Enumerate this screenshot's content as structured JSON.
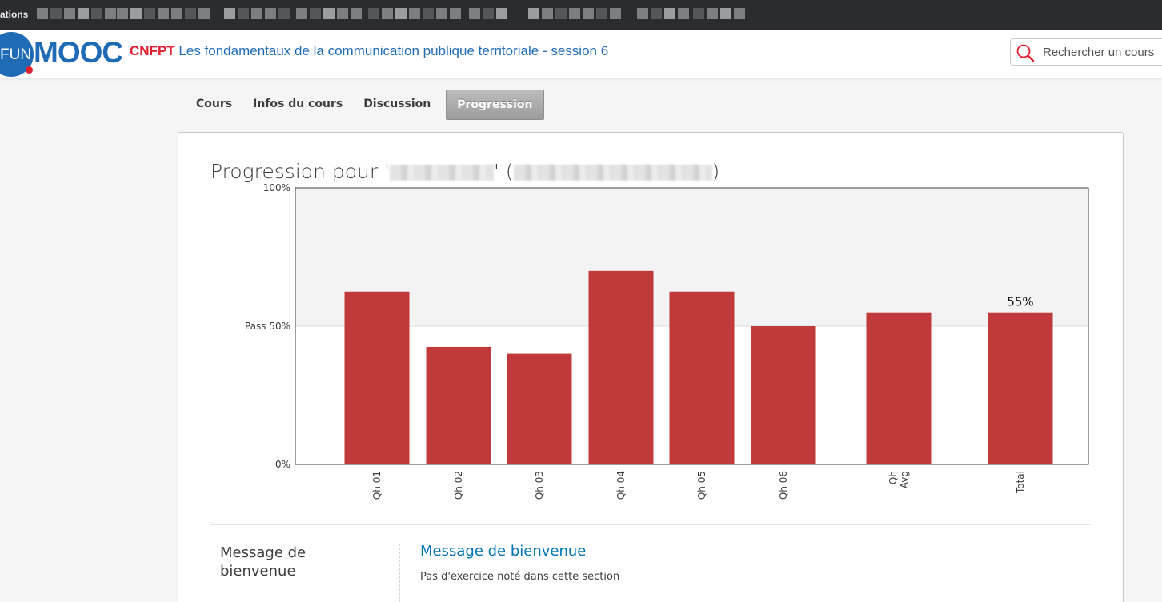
{
  "browser": {
    "bookmarks_first_label": "ations"
  },
  "header": {
    "logo_fun": "FUN",
    "logo_mooc": "MOOC",
    "course_org": "CNFPT",
    "course_title": "Les fondamentaux de la communication publique territoriale - session 6",
    "search_placeholder": "Rechercher un cours",
    "brand_color": "#1f6bb5",
    "accent_color": "#e2202f"
  },
  "tabs": [
    {
      "label": "Cours",
      "active": false
    },
    {
      "label": "Infos du cours",
      "active": false
    },
    {
      "label": "Discussion",
      "active": false
    },
    {
      "label": "Progression",
      "active": true
    }
  ],
  "progress": {
    "title_prefix": "Progression pour '",
    "title_middle": "' (",
    "title_suffix": ")"
  },
  "chart_data": {
    "type": "bar",
    "categories": [
      "Qh 01",
      "Qh 02",
      "Qh 03",
      "Qh 04",
      "Qh 05",
      "Qh 06",
      "Qh\nAvg",
      "Total"
    ],
    "values": [
      62.5,
      42.5,
      40,
      70,
      62.5,
      50,
      55,
      55
    ],
    "data_labels": {
      "Total": "55%"
    },
    "ylim": [
      0,
      100
    ],
    "y_ticks": [
      {
        "value": 0,
        "label": "0%"
      },
      {
        "value": 50,
        "label": "Pass 50%"
      },
      {
        "value": 100,
        "label": "100%"
      }
    ],
    "pass_threshold": 50,
    "bar_color": "#c0393b",
    "above_pass_shade": "#f3f3f3",
    "grid": false
  },
  "sections": [
    {
      "label": "Message de bienvenue",
      "link": "Message de bienvenue",
      "note": "Pas d'exercice noté dans cette section"
    }
  ]
}
